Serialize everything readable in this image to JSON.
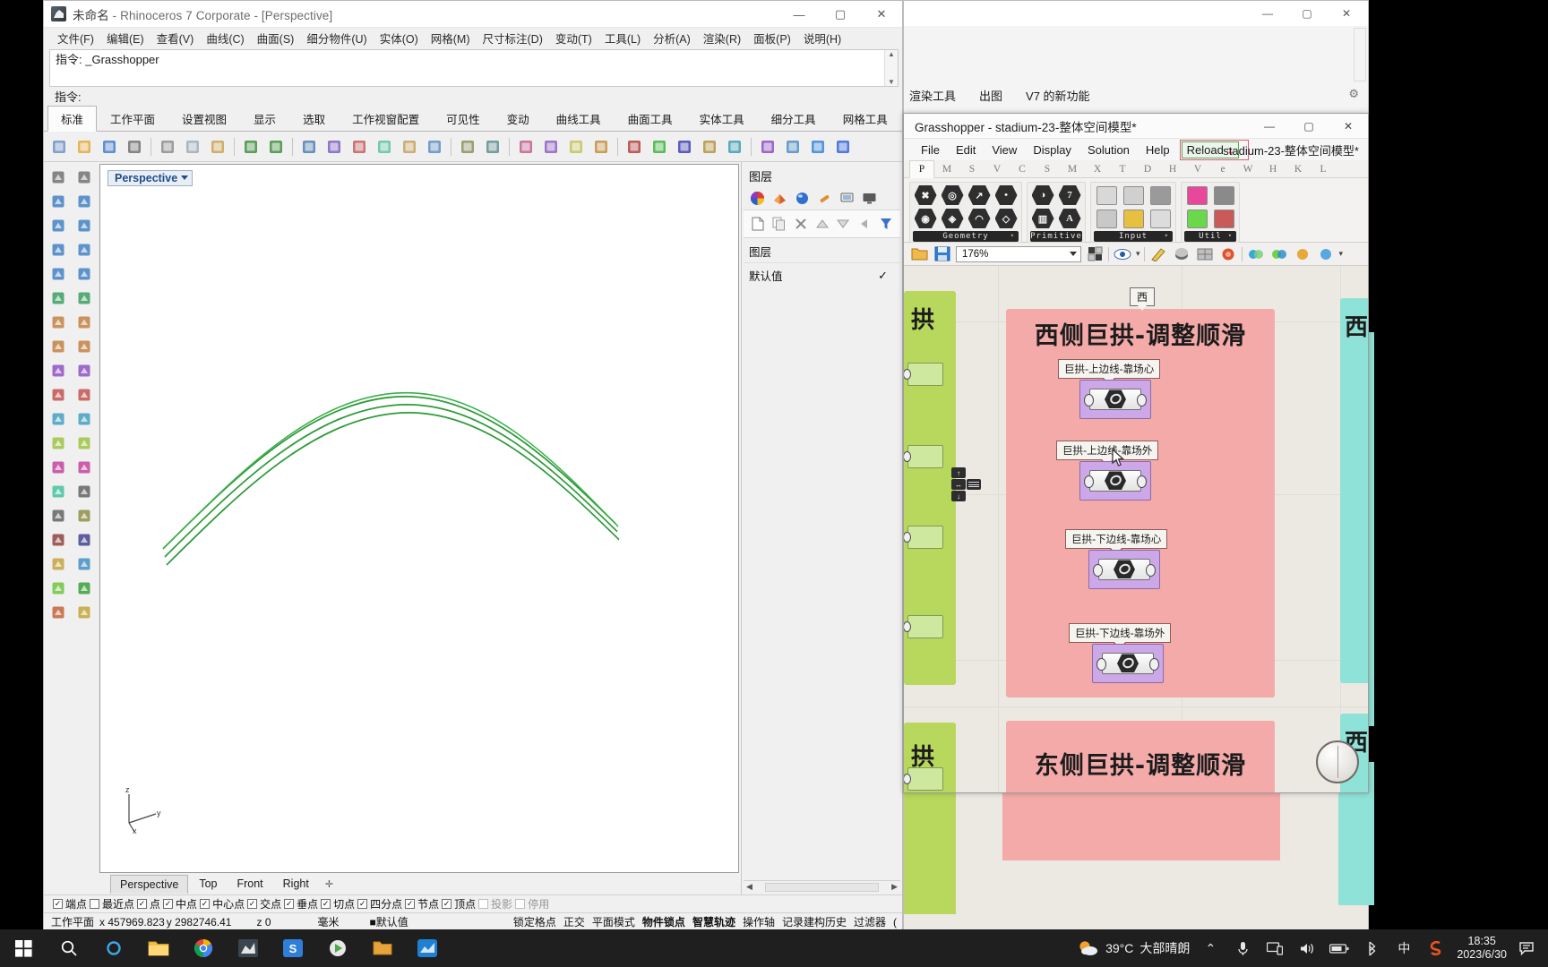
{
  "rhino": {
    "title_doc": "未命名",
    "title_rest": " - Rhinoceros 7 Corporate - [Perspective]",
    "window_buttons": {
      "minimize": "—",
      "maximize": "▢",
      "close": "✕"
    },
    "menu": [
      "文件(F)",
      "编辑(E)",
      "查看(V)",
      "曲线(C)",
      "曲面(S)",
      "细分物件(U)",
      "实体(O)",
      "网格(M)",
      "尺寸标注(D)",
      "变动(T)",
      "工具(L)",
      "分析(A)",
      "渲染(R)",
      "面板(P)",
      "说明(H)"
    ],
    "command_line_1": "指令: _Grasshopper",
    "command_line_2": "指令:",
    "toolbar_tabs": [
      "标准",
      "工作平面",
      "设置视图",
      "显示",
      "选取",
      "工作视窗配置",
      "可见性",
      "变动",
      "曲线工具",
      "曲面工具",
      "实体工具",
      "细分工具",
      "网格工具"
    ],
    "toolbar_tabs_more": "»",
    "active_toolbar_tab": "标准",
    "viewport_label": "Perspective",
    "viewport_tabs": [
      "Perspective",
      "Top",
      "Front",
      "Right"
    ],
    "viewport_tab_add": "✛",
    "axes": {
      "z": "z",
      "y": "y",
      "x": "x"
    },
    "layers_panel": {
      "title": "图层",
      "list_header": "图层",
      "rows": [
        {
          "name": "默认值",
          "check": "✓"
        }
      ]
    },
    "osnaps": [
      {
        "label": "端点",
        "checked": true
      },
      {
        "label": "最近点",
        "checked": false
      },
      {
        "label": "点",
        "checked": true
      },
      {
        "label": "中点",
        "checked": true
      },
      {
        "label": "中心点",
        "checked": true
      },
      {
        "label": "交点",
        "checked": true
      },
      {
        "label": "垂点",
        "checked": true
      },
      {
        "label": "切点",
        "checked": true
      },
      {
        "label": "四分点",
        "checked": true
      },
      {
        "label": "节点",
        "checked": true
      },
      {
        "label": "顶点",
        "checked": true
      },
      {
        "label": "投影",
        "checked": false,
        "dim": true
      },
      {
        "label": "停用",
        "checked": false,
        "dim": true
      }
    ],
    "status": {
      "cplane": "工作平面",
      "x": "x 457969.823",
      "y": "y 2982746.41",
      "z": "z 0",
      "units": "毫米",
      "layer_swatch": "■",
      "layer": "默认值",
      "toggles": [
        "锁定格点",
        "正交",
        "平面模式",
        "物件锁点",
        "智慧轨迹",
        "操作轴",
        "记录建构历史",
        "过滤器"
      ],
      "toggles_bold": [
        "物件锁点",
        "智慧轨迹"
      ],
      "overflow": "("
    }
  },
  "bg_window": {
    "tabs": [
      "渲染工具",
      "出图",
      "V7 的新功能"
    ],
    "gear": "⚙",
    "window_buttons": {
      "minimize": "—",
      "maximize": "▢",
      "close": "✕"
    }
  },
  "grasshopper": {
    "title": "Grasshopper - stadium-23-整体空间模型*",
    "window_buttons": {
      "minimize": "—",
      "maximize": "▢",
      "close": "✕"
    },
    "menu": [
      "File",
      "Edit",
      "View",
      "Display",
      "Solution",
      "Help"
    ],
    "reload_label": "Reload",
    "reload_arrow": "↴",
    "document_tab": "stadium-23-整体空间模型*",
    "ribbon_tab_letters": [
      "P",
      "M",
      "S",
      "V",
      "C",
      "S",
      "M",
      "X",
      "T",
      "D",
      "H",
      "V",
      "e",
      "W",
      "H",
      "K",
      "L"
    ],
    "active_ribbon_tab": "P",
    "ribbon_groups": [
      {
        "label": "Geometry",
        "dropdown": "▾",
        "icons": [
          "x-hex-icon",
          "brep-hex-icon",
          "surface-hex-icon",
          "mesh-hex-icon",
          "vector-hex-icon",
          "curve-hex-icon",
          "point-hex-icon",
          "plane-hex-icon"
        ]
      },
      {
        "label": "Primitive",
        "dropdown": "",
        "icons": [
          "circle-hex-icon",
          "box-hex-icon",
          "number-hex-icon",
          "text-hex-icon"
        ]
      },
      {
        "label": "Input",
        "dropdown": "▾",
        "icons": [
          "panel-icon",
          "button-icon",
          "boolean-toggle-icon",
          "slider-icon",
          "knob-icon",
          "list-icon"
        ]
      },
      {
        "label": "Util",
        "dropdown": "▾",
        "icons": [
          "gradient-icon",
          "colour-swatch-icon",
          "cluster-icon",
          "jump-icon"
        ]
      }
    ],
    "zoom_value": "176%",
    "canvas": {
      "groups": [
        {
          "name": "west-arch-group",
          "title": "西侧巨拱-调整顺滑",
          "color": "#f4aaa8"
        },
        {
          "name": "east-arch-group",
          "title": "东侧巨拱-调整顺滑",
          "color": "#f4aaa8"
        },
        {
          "name": "left-green-group",
          "title": "拱",
          "color": "#b7d85c"
        },
        {
          "name": "right-teal-group",
          "title": "西",
          "color": "#8fe2d8"
        }
      ],
      "west_group_tag": "西",
      "nodes": [
        {
          "tag": "巨拱-上边线-靠场心",
          "type": "curve-param-node"
        },
        {
          "tag": "巨拱-上边线-靠场外",
          "type": "curve-param-node"
        },
        {
          "tag": "巨拱-下边线-靠场心",
          "type": "curve-param-node"
        },
        {
          "tag": "巨拱-下边线-靠场外",
          "type": "curve-param-node"
        }
      ]
    }
  },
  "taskbar": {
    "start": "⊞",
    "apps": [
      "search-icon",
      "cortana-icon",
      "file-explorer-icon",
      "chrome-icon",
      "rhino-icon",
      "s-app-icon",
      "player-icon",
      "folder-yellow-icon",
      "blue-app-icon"
    ],
    "weather_temp": "39°C",
    "weather_desc": "大部晴朗",
    "tray_icons": [
      "chevron-up-icon",
      "mic-icon",
      "display-icon",
      "volume-icon",
      "battery-icon",
      "bluetooth-icon"
    ],
    "ime": "中",
    "sogou": "S",
    "time": "18:35",
    "date": "2023/6/30",
    "notification": "🗨"
  }
}
